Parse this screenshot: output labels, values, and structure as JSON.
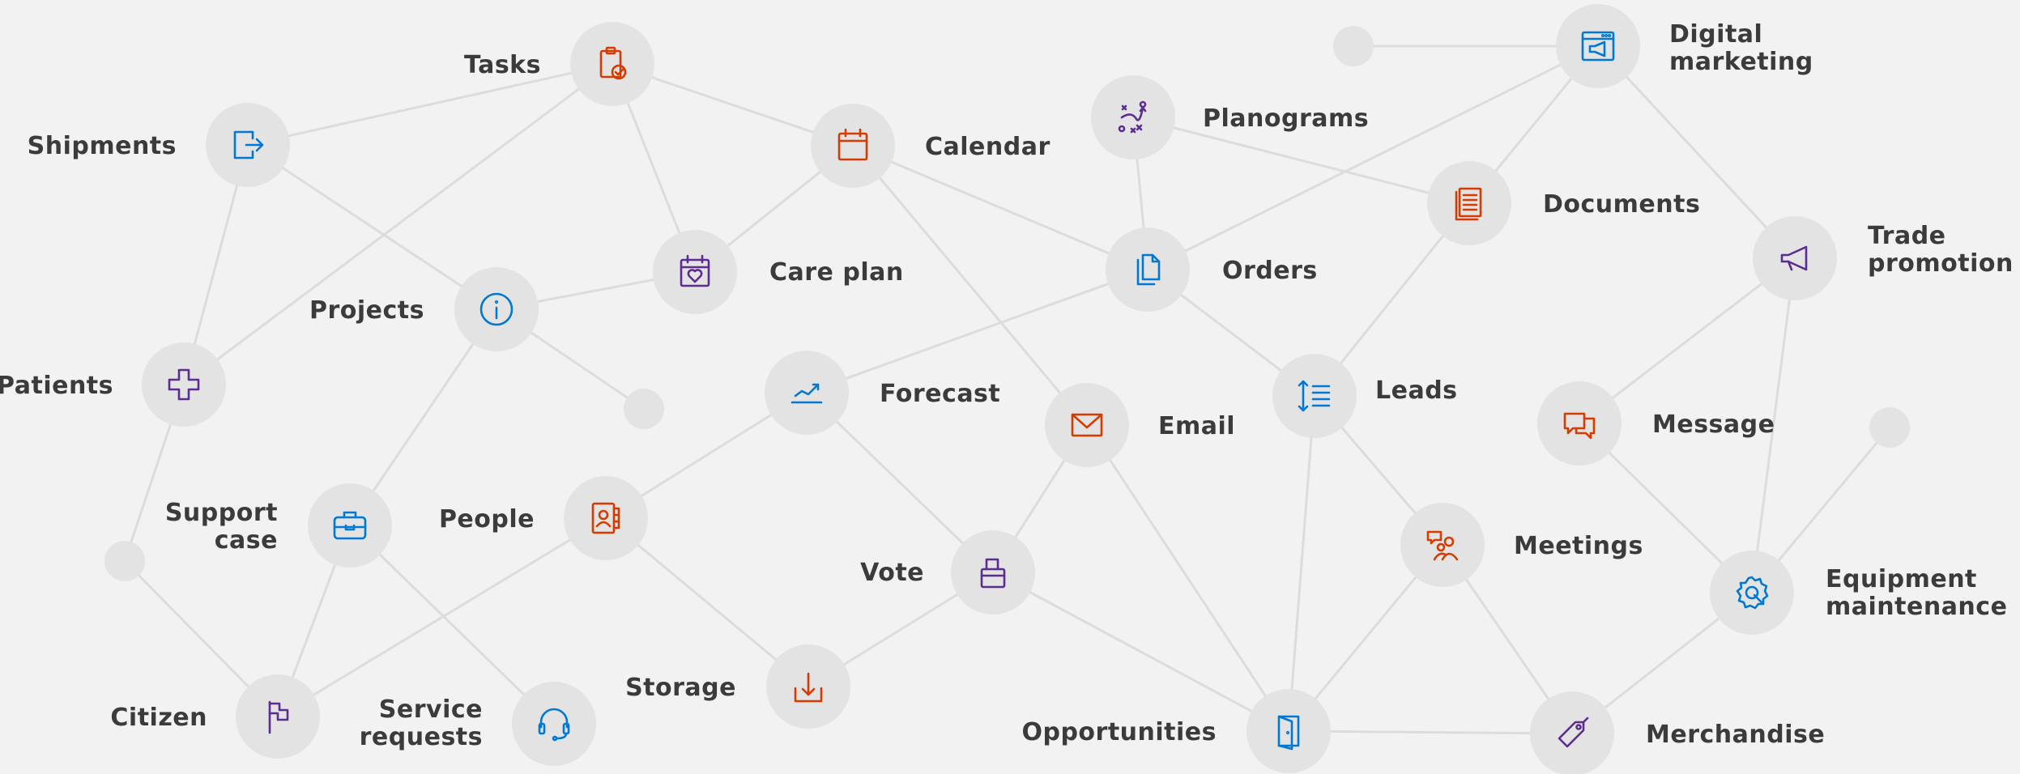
{
  "colors": {
    "blue": "#0078d4",
    "orange": "#d83b01",
    "purple": "#5c2d91"
  },
  "nodes": [
    {
      "id": "tasks",
      "label": [
        "Tasks"
      ],
      "icon": "clipboard-check-icon",
      "color": "orange"
    },
    {
      "id": "shipments",
      "label": [
        "Shipments"
      ],
      "icon": "arrow-exit-icon",
      "color": "blue"
    },
    {
      "id": "calendar",
      "label": [
        "Calendar"
      ],
      "icon": "calendar-icon",
      "color": "orange"
    },
    {
      "id": "care-plan",
      "label": [
        "Care plan"
      ],
      "icon": "calendar-heart-icon",
      "color": "purple"
    },
    {
      "id": "projects",
      "label": [
        "Projects"
      ],
      "icon": "info-icon",
      "color": "blue"
    },
    {
      "id": "patients",
      "label": [
        "Patients"
      ],
      "icon": "medical-cross-icon",
      "color": "purple"
    },
    {
      "id": "forecast",
      "label": [
        "Forecast"
      ],
      "icon": "trend-chart-icon",
      "color": "blue"
    },
    {
      "id": "people",
      "label": [
        "People"
      ],
      "icon": "contact-book-icon",
      "color": "orange"
    },
    {
      "id": "support-case",
      "label": [
        "Support",
        "case"
      ],
      "icon": "briefcase-icon",
      "color": "blue"
    },
    {
      "id": "citizen",
      "label": [
        "Citizen"
      ],
      "icon": "flag-icon",
      "color": "purple"
    },
    {
      "id": "service-requests",
      "label": [
        "Service",
        "requests"
      ],
      "icon": "headset-icon",
      "color": "blue"
    },
    {
      "id": "storage",
      "label": [
        "Storage"
      ],
      "icon": "download-tray-icon",
      "color": "orange"
    },
    {
      "id": "vote",
      "label": [
        "Vote"
      ],
      "icon": "ballot-box-icon",
      "color": "purple"
    },
    {
      "id": "email",
      "label": [
        "Email"
      ],
      "icon": "envelope-icon",
      "color": "orange"
    },
    {
      "id": "planograms",
      "label": [
        "Planograms"
      ],
      "icon": "strategy-play-icon",
      "color": "purple"
    },
    {
      "id": "orders",
      "label": [
        "Orders"
      ],
      "icon": "copy-documents-icon",
      "color": "blue"
    },
    {
      "id": "documents",
      "label": [
        "Documents"
      ],
      "icon": "document-stack-icon",
      "color": "orange"
    },
    {
      "id": "digital-marketing",
      "label": [
        "Digital",
        "marketing"
      ],
      "icon": "browser-megaphone-icon",
      "color": "blue"
    },
    {
      "id": "leads",
      "label": [
        "Leads"
      ],
      "icon": "line-spacing-icon",
      "color": "blue"
    },
    {
      "id": "meetings",
      "label": [
        "Meetings"
      ],
      "icon": "people-chat-icon",
      "color": "orange"
    },
    {
      "id": "opportunities",
      "label": [
        "Opportunities"
      ],
      "icon": "door-icon",
      "color": "blue"
    },
    {
      "id": "trade-promotion",
      "label": [
        "Trade",
        "promotion"
      ],
      "icon": "megaphone-icon",
      "color": "purple"
    },
    {
      "id": "message",
      "label": [
        "Message"
      ],
      "icon": "chat-bubbles-icon",
      "color": "orange"
    },
    {
      "id": "equipment-maintenance",
      "label": [
        "Equipment",
        "maintenance"
      ],
      "icon": "gear-wrench-icon",
      "color": "blue"
    },
    {
      "id": "merchandise",
      "label": [
        "Merchandise"
      ],
      "icon": "price-tag-icon",
      "color": "purple"
    }
  ],
  "empty_nodes": [
    "dot-top",
    "dot-mid",
    "dot-left",
    "dot-right"
  ],
  "edges": [
    [
      "shipments",
      "tasks"
    ],
    [
      "tasks",
      "calendar"
    ],
    [
      "tasks",
      "care-plan"
    ],
    [
      "tasks",
      "patients"
    ],
    [
      "shipments",
      "projects"
    ],
    [
      "shipments",
      "patients"
    ],
    [
      "calendar",
      "care-plan"
    ],
    [
      "calendar",
      "orders"
    ],
    [
      "calendar",
      "email"
    ],
    [
      "projects",
      "care-plan"
    ],
    [
      "projects",
      "dot-mid"
    ],
    [
      "projects",
      "support-case"
    ],
    [
      "patients",
      "dot-left"
    ],
    [
      "dot-left",
      "citizen"
    ],
    [
      "support-case",
      "citizen"
    ],
    [
      "support-case",
      "service-requests"
    ],
    [
      "citizen",
      "people"
    ],
    [
      "people",
      "forecast"
    ],
    [
      "people",
      "storage"
    ],
    [
      "forecast",
      "orders"
    ],
    [
      "forecast",
      "vote"
    ],
    [
      "storage",
      "vote"
    ],
    [
      "vote",
      "email"
    ],
    [
      "vote",
      "opportunities"
    ],
    [
      "email",
      "opportunities"
    ],
    [
      "planograms",
      "orders"
    ],
    [
      "planograms",
      "documents"
    ],
    [
      "orders",
      "digital-marketing"
    ],
    [
      "orders",
      "leads"
    ],
    [
      "dot-top",
      "digital-marketing"
    ],
    [
      "digital-marketing",
      "documents"
    ],
    [
      "digital-marketing",
      "trade-promotion"
    ],
    [
      "documents",
      "leads"
    ],
    [
      "leads",
      "meetings"
    ],
    [
      "leads",
      "opportunities"
    ],
    [
      "meetings",
      "opportunities"
    ],
    [
      "meetings",
      "merchandise"
    ],
    [
      "opportunities",
      "merchandise"
    ],
    [
      "trade-promotion",
      "message"
    ],
    [
      "trade-promotion",
      "equipment-maintenance"
    ],
    [
      "message",
      "equipment-maintenance"
    ],
    [
      "equipment-maintenance",
      "dot-right"
    ],
    [
      "equipment-maintenance",
      "merchandise"
    ]
  ]
}
